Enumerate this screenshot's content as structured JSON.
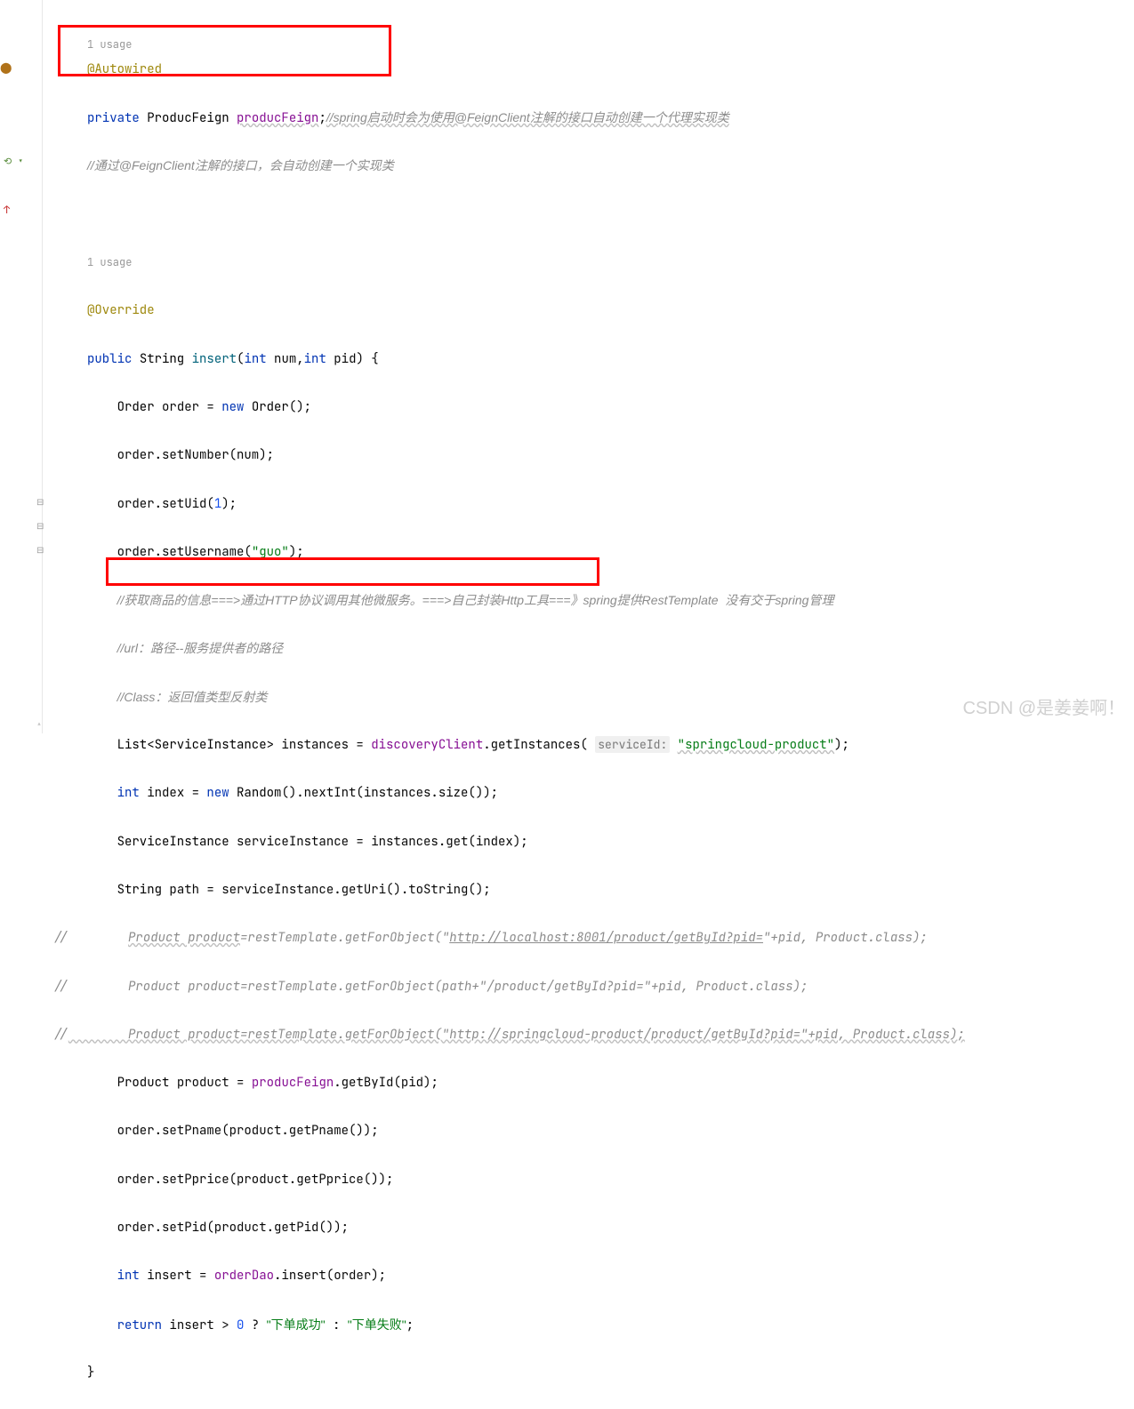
{
  "usages": {
    "usage1": "1 usage",
    "usage2": "1 usage"
  },
  "code": {
    "annotation_autowired": "@Autowired",
    "kw_private": "private",
    "type_producfeign": "ProducFeign",
    "field_producfeign": "producFeign",
    "semicolon": ";",
    "comment_spring_startup": "//spring启动时会为使用@FeignClient注解的接口自动创建一个代理实现类",
    "comment_feign_client": "//通过@FeignClient注解的接口，会自动创建一个实现类",
    "annotation_override": "@Override",
    "kw_public": "public",
    "type_string": "String",
    "method_insert": "insert",
    "kw_int": "int",
    "param_num": "num",
    "param_pid": "pid",
    "type_order": "Order",
    "var_order": "order",
    "kw_new": "new",
    "method_setnumber": ".setNumber(num);",
    "method_setuid": ".setUid(",
    "num_1": "1",
    "method_setusername": ".setUsername(",
    "str_guo": "\"guo\"",
    "comment_http": "//获取商品的信息===>通过HTTP协议调用其他微服务。===>自己封装Http工具===》spring提供RestTemplate  没有交于spring管理",
    "comment_url": "//url：路径--服务提供者的路径",
    "comment_class": "//Class：返回值类型反射类",
    "type_list": "List<ServiceInstance>",
    "var_instances": "instances",
    "field_discoveryclient": "discoveryClient",
    "method_getinstances": ".getInstances(",
    "hint_serviceid": "serviceId:",
    "str_springcloud": "\"springcloud-product\"",
    "var_index": "index",
    "type_random": "Random",
    "method_nextint": "().nextInt(instances.size());",
    "type_serviceinstance": "ServiceInstance",
    "var_serviceinstance": "serviceInstance",
    "method_instances_get": "instances.get(index);",
    "var_path": "path",
    "method_geturi": "serviceInstance.getUri().toString();",
    "comment_line_prefix": "//",
    "comment_product1_a": "Product product",
    "comment_product1_b": "=restTemplate.getForObject(\"",
    "comment_product1_url": "http://localhost:8001/product/getById?pid=",
    "comment_product1_c": "\"+pid, Product.class);",
    "comment_product2": "        Product product=restTemplate.getForObject(path+\"/product/getById?pid=\"+pid, Product.class);",
    "comment_product3": "        Product product=restTemplate.getForObject(\"http://springcloud-product/product/getById?pid=\"+pid, Product.class);",
    "type_product": "Product",
    "var_product": "product",
    "method_getbyid": ".getById(pid);",
    "method_setpname": ".setPname(product.getPname());",
    "method_setpprice": ".setPprice(product.getPprice());",
    "method_setpid": ".setPid(product.getPid());",
    "var_insert": "insert",
    "field_orderdao": "orderDao",
    "method_dao_insert": ".insert(order);",
    "kw_return": "return",
    "num_0": "0",
    "str_success": "\"下单成功\"",
    "str_fail": "\"下单失败\"",
    "closing_brace": "}"
  },
  "watermark": "CSDN @是姜姜啊！"
}
